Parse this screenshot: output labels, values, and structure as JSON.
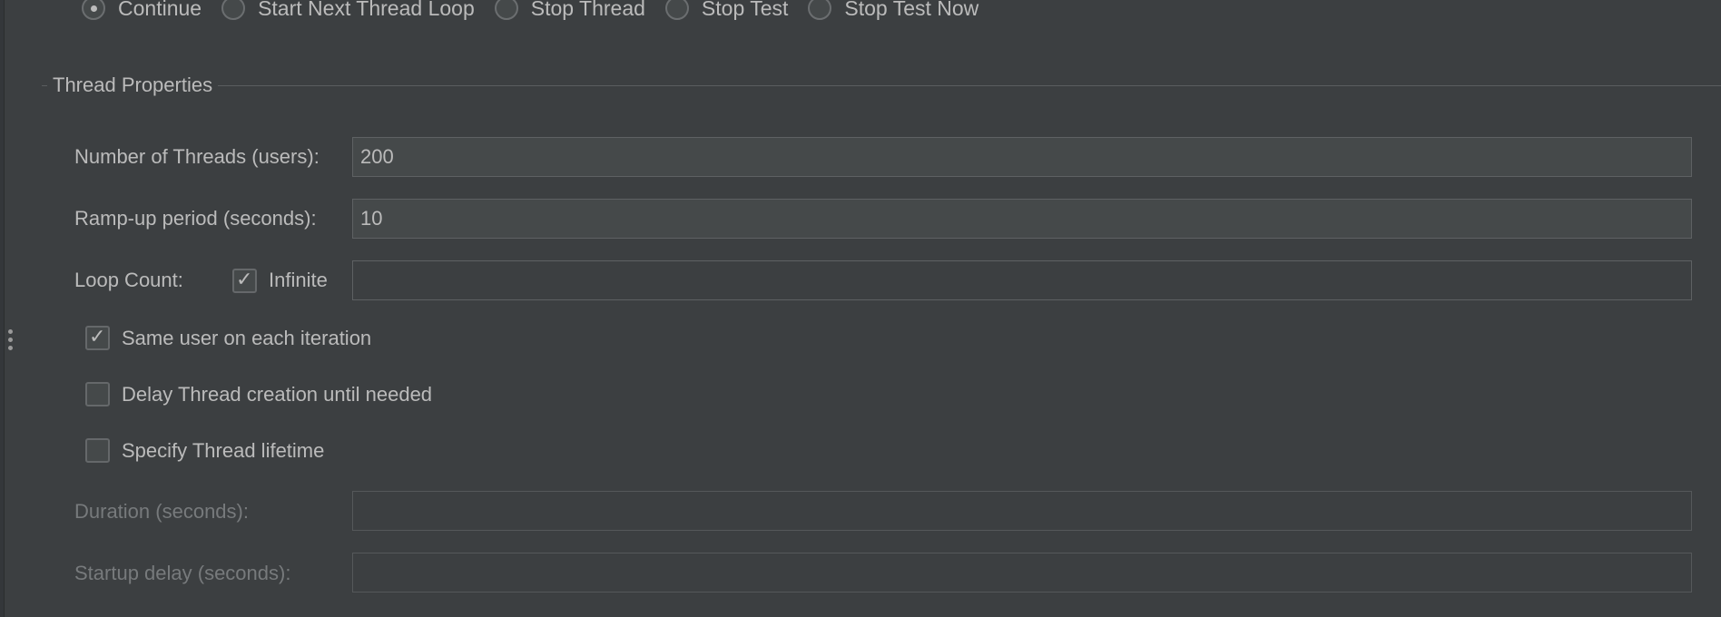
{
  "on_error_actions": {
    "options": [
      {
        "label": "Continue",
        "checked": true
      },
      {
        "label": "Start Next Thread Loop",
        "checked": false
      },
      {
        "label": "Stop Thread",
        "checked": false
      },
      {
        "label": "Stop Test",
        "checked": false
      },
      {
        "label": "Stop Test Now",
        "checked": false
      }
    ]
  },
  "thread_properties": {
    "title": "Thread Properties",
    "num_threads": {
      "label": "Number of Threads (users):",
      "value": "200"
    },
    "ramp_up": {
      "label": "Ramp-up period (seconds):",
      "value": "10"
    },
    "loop_count": {
      "label": "Loop Count:",
      "infinite_label": "Infinite",
      "infinite_checked": true,
      "value": ""
    },
    "same_user": {
      "label": "Same user on each iteration",
      "checked": true
    },
    "delay_creation": {
      "label": "Delay Thread creation until needed",
      "checked": false
    },
    "specify_lifetime": {
      "label": "Specify Thread lifetime",
      "checked": false
    },
    "duration": {
      "label": "Duration (seconds):",
      "value": "",
      "enabled": false
    },
    "startup_delay": {
      "label": "Startup delay (seconds):",
      "value": "",
      "enabled": false
    }
  },
  "icons": {
    "tick": "✓"
  }
}
